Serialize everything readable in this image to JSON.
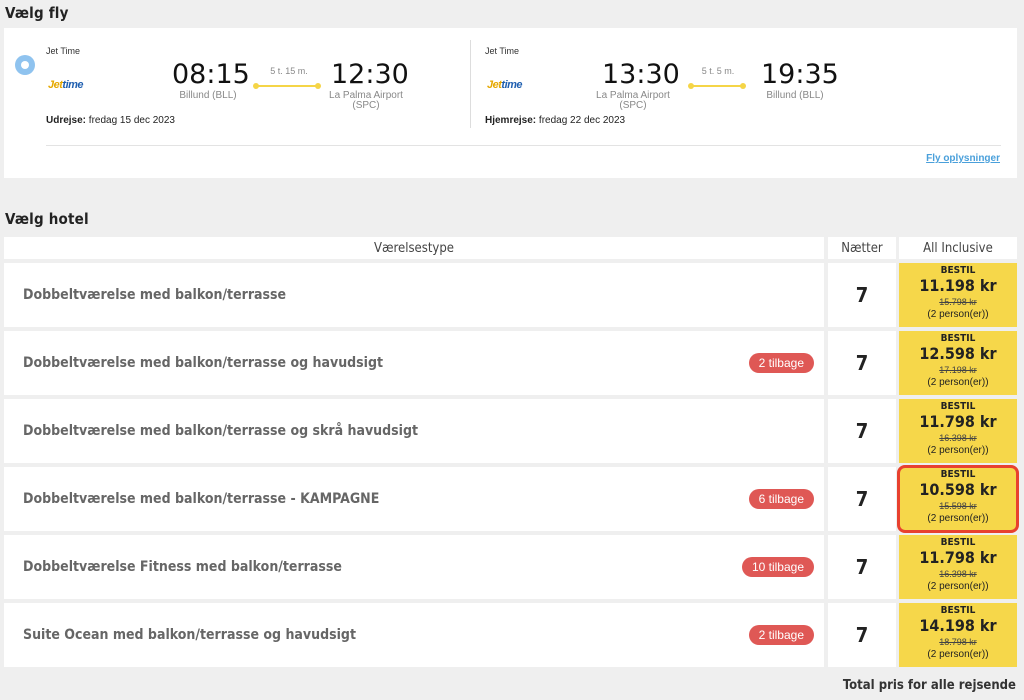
{
  "flight_section": {
    "title": "Vælg fly",
    "outbound": {
      "airline": "Jet Time",
      "logo_a": "Jet",
      "logo_b": "time",
      "depart_time": "08:15",
      "depart_airport": "Billund (BLL)",
      "duration": "5 t. 15 m.",
      "arrive_time": "12:30",
      "arrive_airport_line1": "La Palma Airport",
      "arrive_airport_line2": "(SPC)",
      "date_label": "Udrejse:",
      "date_value": "fredag 15 dec 2023"
    },
    "return": {
      "airline": "Jet Time",
      "logo_a": "Jet",
      "logo_b": "time",
      "depart_time": "13:30",
      "depart_airport_line1": "La Palma Airport",
      "depart_airport_line2": "(SPC)",
      "duration": "5 t. 5 m.",
      "arrive_time": "19:35",
      "arrive_airport": "Billund (BLL)",
      "date_label": "Hjemrejse:",
      "date_value": "fredag 22 dec 2023"
    },
    "info_link": "Fly oplysninger"
  },
  "hotel_section": {
    "title": "Vælg hotel",
    "headers": {
      "room_type": "Værelsestype",
      "nights": "Nætter",
      "board": "All Inclusive"
    },
    "rows": [
      {
        "room": "Dobbeltværelse med balkon/terrasse",
        "badge": "",
        "nights": "7",
        "bestil": "BESTIL",
        "price": "11.198 kr",
        "old_price": "15.798 kr",
        "persons": "(2 person(er))"
      },
      {
        "room": "Dobbeltværelse med balkon/terrasse og havudsigt",
        "badge": "2 tilbage",
        "nights": "7",
        "bestil": "BESTIL",
        "price": "12.598 kr",
        "old_price": "17.198 kr",
        "persons": "(2 person(er))"
      },
      {
        "room": "Dobbeltværelse med balkon/terrasse og skrå havudsigt",
        "badge": "",
        "nights": "7",
        "bestil": "BESTIL",
        "price": "11.798 kr",
        "old_price": "16.398 kr",
        "persons": "(2 person(er))"
      },
      {
        "room": "Dobbeltværelse med balkon/terrasse - KAMPAGNE",
        "badge": "6 tilbage",
        "nights": "7",
        "bestil": "BESTIL",
        "price": "10.598 kr",
        "old_price": "15.598 kr",
        "persons": "(2 person(er))"
      },
      {
        "room": "Dobbeltværelse Fitness med balkon/terrasse",
        "badge": "10 tilbage",
        "nights": "7",
        "bestil": "BESTIL",
        "price": "11.798 kr",
        "old_price": "16.398 kr",
        "persons": "(2 person(er))"
      },
      {
        "room": "Suite Ocean med balkon/terrasse og havudsigt",
        "badge": "2 tilbage",
        "nights": "7",
        "bestil": "BESTIL",
        "price": "14.198 kr",
        "old_price": "18.798 kr",
        "persons": "(2 person(er))"
      }
    ],
    "total_label": "Total pris for alle rejsende"
  },
  "colors": {
    "price_bg": "#f6d74a",
    "badge_bg": "#df5855",
    "selected_outline": "#e8412f",
    "link": "#4aa0db"
  }
}
